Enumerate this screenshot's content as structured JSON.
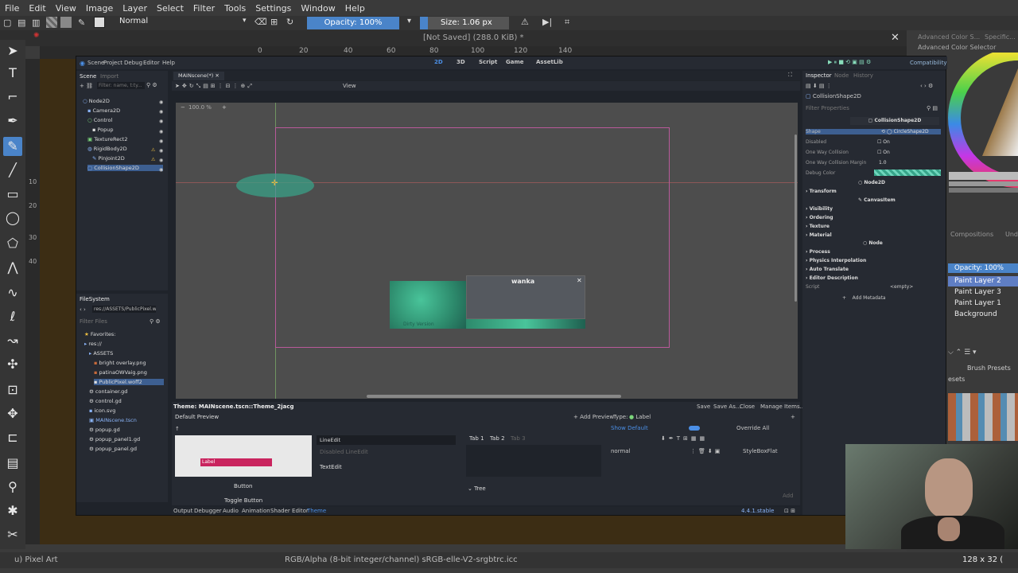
{
  "krita": {
    "menu": [
      "File",
      "Edit",
      "View",
      "Image",
      "Layer",
      "Select",
      "Filter",
      "Tools",
      "Settings",
      "Window",
      "Help"
    ],
    "blend_mode": "Normal",
    "opacity": "Opacity: 100%",
    "size": "Size: 1.06 px",
    "doc_title": "[Not Saved] (288.0 KiB) *",
    "ruler_top": [
      "0",
      "20",
      "40",
      "60",
      "80",
      "100",
      "120",
      "140"
    ],
    "ruler_left": [
      "10",
      "20",
      "30",
      "40"
    ],
    "dock_tabs": [
      "Advanced Color S...",
      "Specific..."
    ],
    "color_selector_title": "Advanced Color Selector",
    "compositions_tab": "Compositions",
    "und_tab": "Und",
    "layers": {
      "opacity": "Opacity: 100%",
      "items": [
        "Paint Layer 2",
        "Paint Layer 3",
        "Paint Layer 1",
        "Background"
      ],
      "selected": 0
    },
    "brush_presets_tab": "Brush Presets",
    "presets_label": "esets",
    "status": {
      "left": "u) Pixel Art",
      "center": "RGB/Alpha (8-bit integer/channel)  sRGB-elle-V2-srgbtrc.icc",
      "right": "128 x 32 ("
    }
  },
  "godot": {
    "menu": [
      "Scene",
      "Project",
      "Debug",
      "Editor",
      "Help"
    ],
    "workspaces": [
      "2D",
      "3D",
      "Script",
      "Game",
      "AssetLib"
    ],
    "renderer": "Compatibility",
    "scene_tabs": [
      "Scene",
      "Import"
    ],
    "scene_filter_placeholder": "Filter: name, t:ty...",
    "scene_tree": [
      {
        "name": "Node2D",
        "depth": 0
      },
      {
        "name": "Camera2D",
        "depth": 1
      },
      {
        "name": "Control",
        "depth": 1
      },
      {
        "name": "Popup",
        "depth": 2
      },
      {
        "name": "TextureRect2",
        "depth": 1
      },
      {
        "name": "RigidBody2D",
        "depth": 1
      },
      {
        "name": "PinJoint2D",
        "depth": 2
      },
      {
        "name": "CollisionShape2D",
        "depth": 1
      }
    ],
    "open_tab": "MAINscene(*)",
    "viewport_toolbar": {
      "view": "View",
      "zoom": "100.0 %"
    },
    "popup_title": "wanka",
    "popup_text": "Dirty Version",
    "filesystem": {
      "title": "FileSystem",
      "path": "res://ASSETS/PublicPixel.w",
      "filter_placeholder": "Filter Files",
      "items": [
        {
          "name": "Favorites:",
          "depth": 0
        },
        {
          "name": "res://",
          "depth": 0
        },
        {
          "name": "ASSETS",
          "depth": 1
        },
        {
          "name": "bright overlay.png",
          "depth": 2
        },
        {
          "name": "patinaOWVaig.png",
          "depth": 2
        },
        {
          "name": "PublicPixel.woff2",
          "depth": 2
        },
        {
          "name": "container.gd",
          "depth": 1
        },
        {
          "name": "control.gd",
          "depth": 1
        },
        {
          "name": "icon.svg",
          "depth": 1
        },
        {
          "name": "MAINscene.tscn",
          "depth": 1
        },
        {
          "name": "popup.gd",
          "depth": 1
        },
        {
          "name": "popup_panel1.gd",
          "depth": 1
        },
        {
          "name": "popup_panel.gd",
          "depth": 1
        }
      ]
    },
    "theme_editor": {
      "title": "Theme: MAINscene.tscn::Theme_2jacg",
      "actions": [
        "Save",
        "Save As...",
        "Close",
        "Manage Items..."
      ],
      "default_preview": "Default Preview",
      "add_preview": "Add Preview",
      "type_label": "Type:",
      "type_value": "Label",
      "show_default": "Show Default",
      "override_all": "Override All",
      "style_row": "normal",
      "style_value": "StyleBoxFlat",
      "preview_label": "Label",
      "preview_button": "Button",
      "preview_toggle": "Toggle Button",
      "line_edit": "LineEdit",
      "disabled_line_edit": "Disabled LineEdit",
      "text_edit": "TextEdit",
      "tabs": [
        "Tab 1",
        "Tab 2",
        "Tab 3"
      ],
      "tree": "Tree",
      "add": "Add"
    },
    "bottom_tabs": [
      "Output",
      "Debugger",
      "Audio",
      "Animation",
      "Shader Editor",
      "Theme"
    ],
    "version": "4.4.1.stable",
    "inspector": {
      "tabs": [
        "Inspector",
        "Node",
        "History"
      ],
      "node": "CollisionShape2D",
      "filter_placeholder": "Filter Properties",
      "class_header": "CollisionShape2D",
      "rows": [
        {
          "label": "Shape",
          "value": "CircleShape2D"
        },
        {
          "label": "Disabled",
          "value": "On"
        },
        {
          "label": "One Way Collision",
          "value": "On"
        },
        {
          "label": "One Way Collision Margin",
          "value": "1.0"
        },
        {
          "label": "Debug Color",
          "value": ""
        }
      ],
      "node2d": "Node2D",
      "transform": "Transform",
      "canvasitem": "CanvasItem",
      "canvas_sections": [
        "Visibility",
        "Ordering",
        "Texture",
        "Material"
      ],
      "node_header": "Node",
      "node_sections": [
        "Process",
        "Physics Interpolation",
        "Auto Translate",
        "Editor Description"
      ],
      "script_label": "Script",
      "script_value": "<empty>",
      "add_metadata": "Add Metadata"
    }
  },
  "colors": {
    "godot_accent": "#4b8fe6",
    "selection": "#3d5f91",
    "layer_selected": "#5f7ec4",
    "teal": "#37a58a",
    "label_pink": "#c9245e"
  }
}
